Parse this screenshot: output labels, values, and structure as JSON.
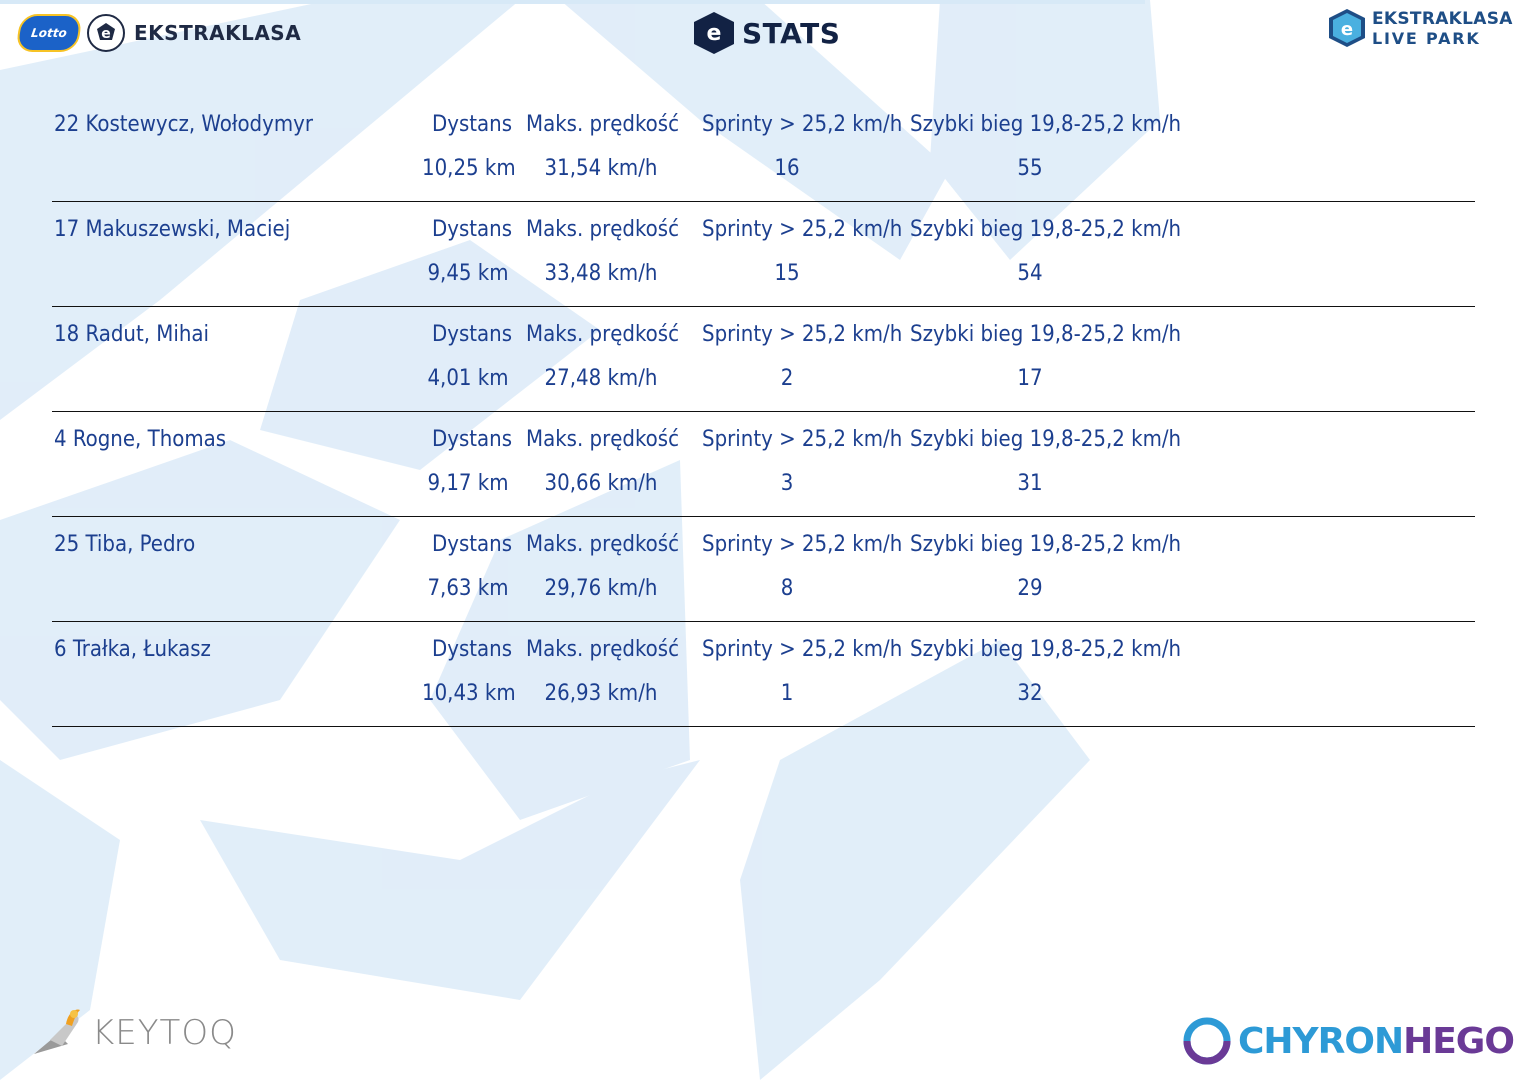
{
  "header": {
    "left_logo": {
      "badge": "Lotto",
      "text": "EKSTRAKLASA"
    },
    "center_logo": {
      "text": "STATS"
    },
    "right_logo": {
      "line1": "EKSTRAKLASA",
      "line2": "LIVE PARK"
    }
  },
  "labels": {
    "distance": "Dystans",
    "max_speed": "Maks. prędkość",
    "sprints": "Sprinty > 25,2 km/h",
    "fast_run": "Szybki bieg 19,8-25,2 km/h"
  },
  "players": [
    {
      "name": "22  Kostewycz, Wołodymyr",
      "distance": "10,25 km",
      "max_speed": "31,54 km/h",
      "sprints": "16",
      "fast_run": "55"
    },
    {
      "name": "17  Makuszewski, Maciej",
      "distance": "9,45 km",
      "max_speed": "33,48 km/h",
      "sprints": "15",
      "fast_run": "54"
    },
    {
      "name": "18  Radut, Mihai",
      "distance": "4,01 km",
      "max_speed": "27,48 km/h",
      "sprints": "2",
      "fast_run": "17"
    },
    {
      "name": "4  Rogne, Thomas",
      "distance": "9,17 km",
      "max_speed": "30,66 km/h",
      "sprints": "3",
      "fast_run": "31"
    },
    {
      "name": "25  Tiba, Pedro",
      "distance": "7,63 km",
      "max_speed": "29,76 km/h",
      "sprints": "8",
      "fast_run": "29"
    },
    {
      "name": "6  Trałka, Łukasz",
      "distance": "10,43 km",
      "max_speed": "26,93 km/h",
      "sprints": "1",
      "fast_run": "32"
    }
  ],
  "footer": {
    "left_logo": "KEYTOQ",
    "right_logo_part1": "CHYRON",
    "right_logo_part2": "HEGO"
  }
}
